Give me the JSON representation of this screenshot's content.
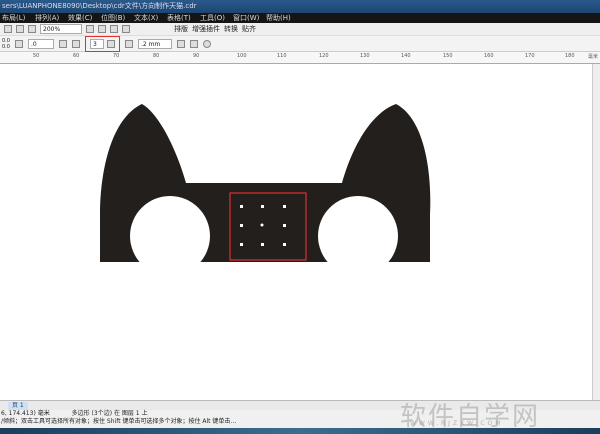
{
  "window": {
    "title": "sers\\LUANPHONE8090\\Desktop\\cdr文件\\方向制作天猫.cdr"
  },
  "menu": [
    "布局(L)",
    "排列(A)",
    "效果(C)",
    "位图(B)",
    "文本(X)",
    "表格(T)",
    "工具(O)",
    "窗口(W)",
    "帮助(H)"
  ],
  "toolbar": {
    "zoom": "200%",
    "buttons": [
      "排版",
      "增强插件",
      "转换",
      "贴齐"
    ]
  },
  "propbar": {
    "x": "0.0",
    "y": "0.0",
    "rotation": ".0",
    "sides": "3",
    "outline": ".2 mm"
  },
  "ruler": [
    "50",
    "60",
    "70",
    "80",
    "90",
    "100",
    "110",
    "120",
    "130",
    "140",
    "150",
    "160",
    "170",
    "180",
    "毫米"
  ],
  "page": {
    "tab": "页 1"
  },
  "status": {
    "coords": "6, 174.413) 毫米",
    "object": "多边形 (3个边) 在 图层 1 上",
    "hint": "/倾斜；双击工具可选择所有对象；按住 Shift 键单击可选择多个对象；按住 Alt 键单击..."
  },
  "watermark": {
    "text": "软件自学网",
    "url": "WWW.RJZXW.COM"
  },
  "colors": {
    "shape": "#231f1c",
    "selection": "#e03030"
  }
}
